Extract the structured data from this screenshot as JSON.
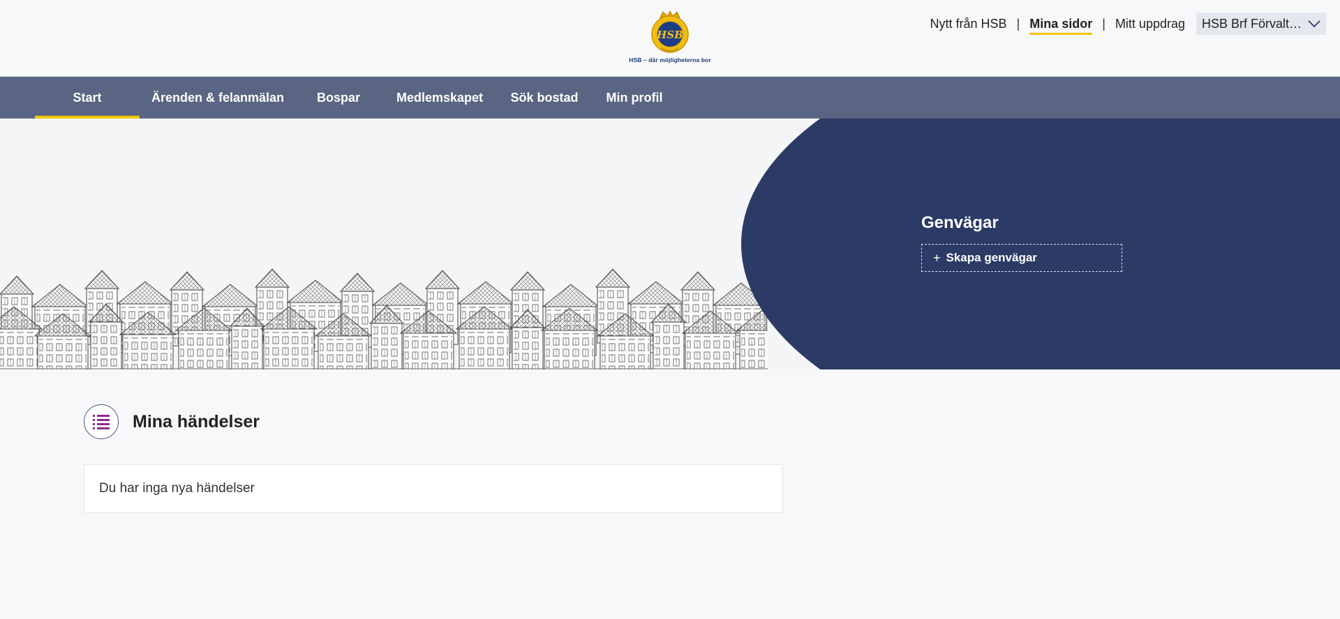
{
  "header": {
    "logo_text": "HSB",
    "logo_tagline": "HSB – där möjligheterna bor",
    "links": [
      {
        "label": "Nytt från HSB"
      },
      {
        "label": "Mina sidor",
        "active": true
      },
      {
        "label": "Mitt uppdrag"
      }
    ],
    "account_select": {
      "value": "HSB Brf Förvaltar...",
      "icon": "chevron-down-icon"
    }
  },
  "nav": {
    "items": [
      {
        "label": "Start",
        "active": true
      },
      {
        "label": "Ärenden & felanmälan"
      },
      {
        "label": "Bospar"
      },
      {
        "label": "Medlemskapet"
      },
      {
        "label": "Sök bostad"
      },
      {
        "label": "Min profil"
      }
    ]
  },
  "shortcuts": {
    "title": "Genvägar",
    "create_label": "Skapa genvägar",
    "create_icon": "plus-icon"
  },
  "events": {
    "title": "Mina händelser",
    "icon": "list-icon",
    "empty_text": "Du har inga nya händelser"
  },
  "colors": {
    "nav_bg": "#596582",
    "accent_yellow": "#f5c400",
    "hero_panel": "#2c3a66",
    "page_bg": "#f7f8fa"
  }
}
